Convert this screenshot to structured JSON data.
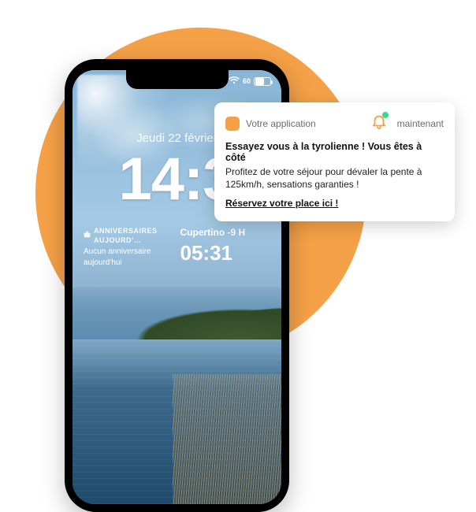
{
  "lockscreen": {
    "date": "Jeudi 22 février",
    "time": "14:3",
    "battery_pct": 60,
    "battery_text": "60",
    "widgets": {
      "birthdays": {
        "header": "ANNIVERSAIRES AUJOURD'…",
        "text": "Aucun anniversaire aujourd'hui"
      },
      "world_clock": {
        "city": "Cupertino",
        "offset": "-9 H",
        "time": "05:31"
      }
    }
  },
  "notification": {
    "app_name": "Votre application",
    "timestamp": "maintenant",
    "title": "Essayez vous à la tyrolienne ! Vous êtes à côté",
    "body": "Profitez de votre séjour pour dévaler la pente à 125km/h, sensations garanties !",
    "cta": "Réservez votre place ici !"
  },
  "colors": {
    "accent": "#f5a147",
    "bell": "#f5a147",
    "badge": "#36d98f"
  }
}
